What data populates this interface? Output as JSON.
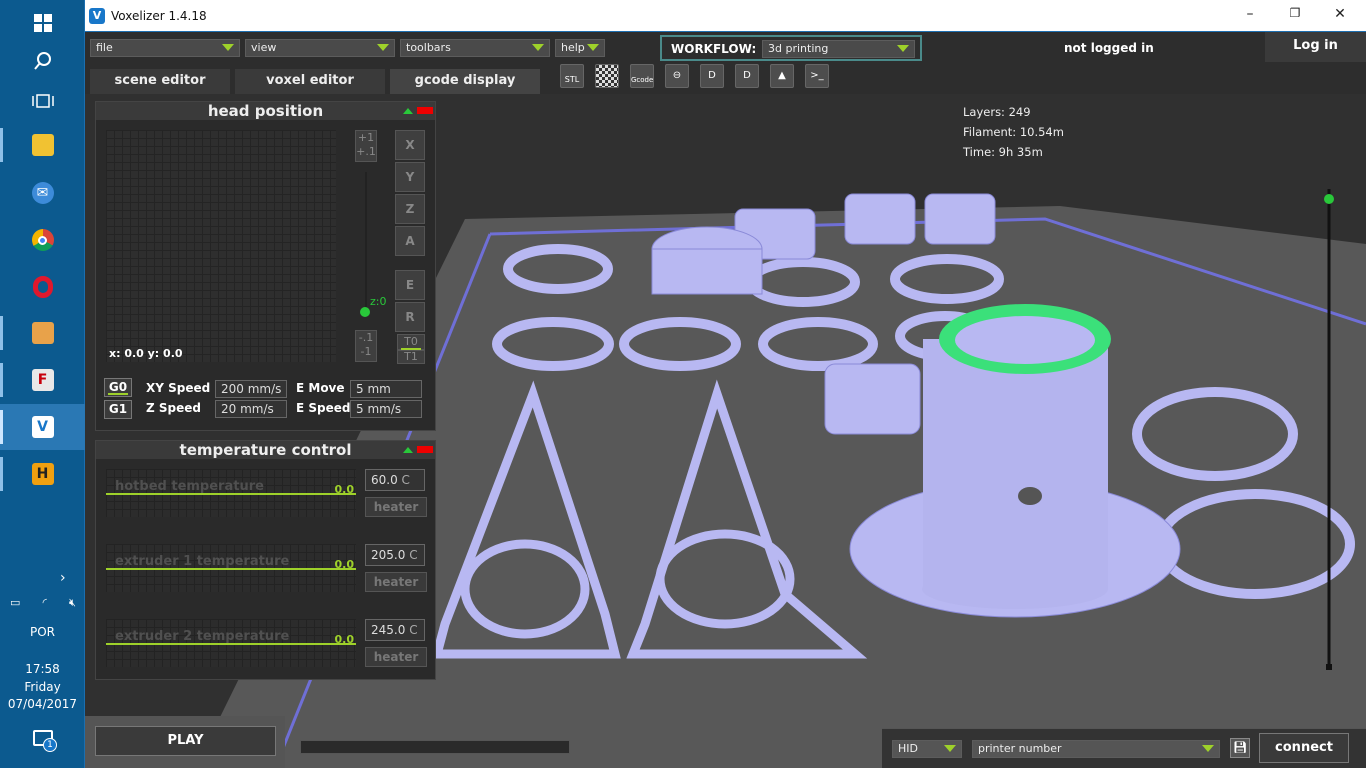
{
  "app": {
    "title": "Voxelizer 1.4.18",
    "icon_letter": "V"
  },
  "window_controls": {
    "minimize": "–",
    "restore": "❐",
    "close": "✕"
  },
  "taskbar": {
    "items": [
      "windows-start-icon",
      "search-icon",
      "task-view-icon",
      "file-explorer-icon",
      "thunderbird-icon",
      "chrome-icon",
      "opera-icon",
      "app-installer-icon",
      "filezilla-icon",
      "voxelizer-icon",
      "h-app-icon"
    ],
    "language": "POR",
    "time": "17:58",
    "day": "Friday",
    "date": "07/04/2017",
    "notification_count": "1"
  },
  "menus": {
    "file": "file",
    "view": "view",
    "toolbars": "toolbars",
    "help": "help"
  },
  "workflow": {
    "label": "WORKFLOW:",
    "value": "3d printing"
  },
  "login": {
    "status": "not logged in",
    "button": "Log in"
  },
  "tabs": [
    "scene editor",
    "voxel editor",
    "gcode display"
  ],
  "tools": {
    "stl": "STL",
    "gcode": "Gcode"
  },
  "stats": {
    "layers": "Layers: 249",
    "filament": "Filament: 10.54m",
    "time": "Time: 9h 35m"
  },
  "head_position": {
    "title": "head position",
    "coords": "x: 0.0 y: 0.0",
    "z_label": "z:0",
    "step_up_1": "+1",
    "step_up_01": "+.1",
    "step_down_01": "-.1",
    "step_down_1": "-1",
    "axes": [
      "X",
      "Y",
      "Z",
      "A",
      "E",
      "R"
    ],
    "t0": "T0",
    "t1": "T1",
    "g0": "G0",
    "g1": "G1",
    "xy_speed_label": "XY Speed",
    "xy_speed": "200 mm/s",
    "z_speed_label": "Z Speed",
    "z_speed": "20 mm/s",
    "e_move_label": "E Move",
    "e_move": "5 mm",
    "e_speed_label": "E Speed",
    "e_speed": "5 mm/s"
  },
  "temperature_control": {
    "title": "temperature control",
    "heater_label": "heater",
    "rows": [
      {
        "name": "hotbed temperature",
        "current": "0.0",
        "setpoint": "60.0",
        "unit": "C"
      },
      {
        "name": "extruder 1 temperature",
        "current": "0.0",
        "setpoint": "205.0",
        "unit": "C"
      },
      {
        "name": "extruder 2 temperature",
        "current": "0.0",
        "setpoint": "245.0",
        "unit": "C"
      }
    ]
  },
  "bottom": {
    "play": "PLAY",
    "interface": "HID",
    "printer_placeholder": "printer number",
    "connect": "connect"
  },
  "colors": {
    "accent_green": "#9ed12a",
    "model_lavender": "#b8b8f2",
    "highlight_green": "#3be07a",
    "bed_gray": "#585858"
  }
}
